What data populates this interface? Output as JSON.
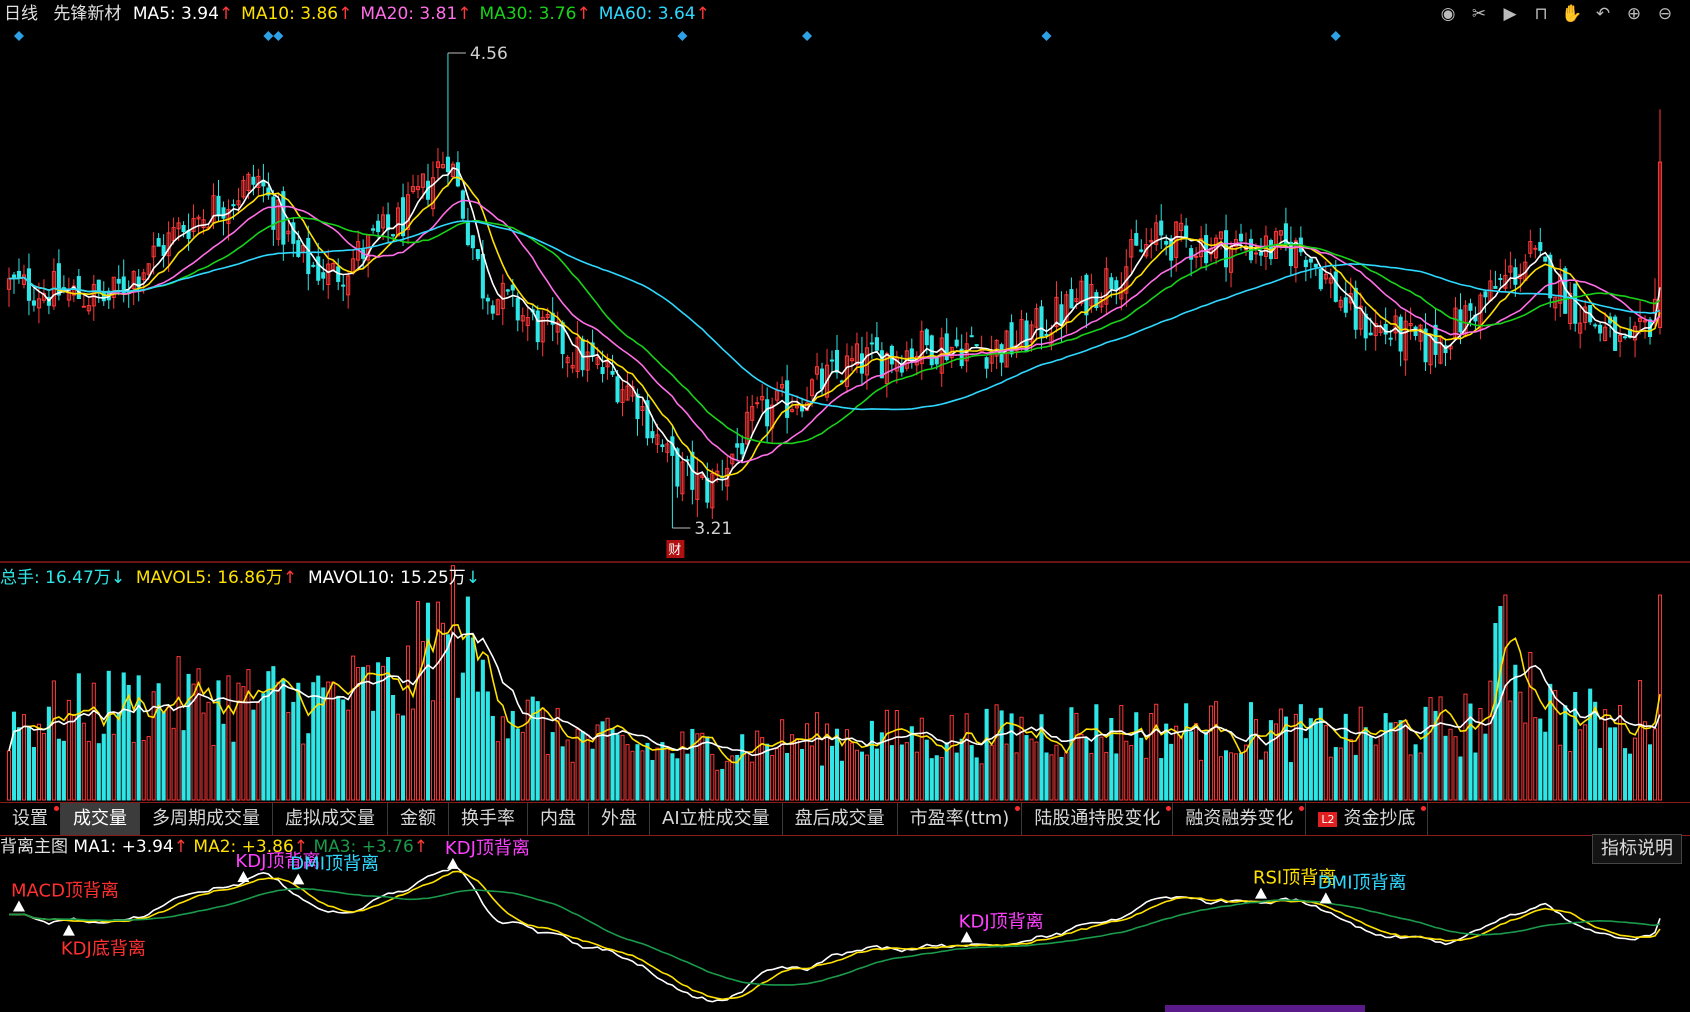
{
  "header": {
    "period": "日线",
    "stock_name": "先锋新材",
    "ma": [
      {
        "label": "MA5",
        "value": "3.94",
        "arrow": "↑",
        "color": "#ffffff"
      },
      {
        "label": "MA10",
        "value": "3.86",
        "arrow": "↑",
        "color": "#ffe100"
      },
      {
        "label": "MA20",
        "value": "3.81",
        "arrow": "↑",
        "color": "#ff6ee6"
      },
      {
        "label": "MA30",
        "value": "3.76",
        "arrow": "↑",
        "color": "#19d219"
      },
      {
        "label": "MA60",
        "value": "3.64",
        "arrow": "↑",
        "color": "#2ed8ff"
      }
    ],
    "tool_icons": [
      "eye-icon",
      "scissors-icon",
      "play-icon",
      "lock-icon",
      "hand-icon",
      "undo-icon",
      "zoom-in-icon",
      "zoom-out-icon"
    ]
  },
  "volume": {
    "total_label": "总手:",
    "total_value": "16.47万",
    "total_arrow": "↓",
    "mavol5_label": "MAVOL5:",
    "mavol5_value": "16.86万",
    "mavol5_arrow": "↑",
    "mavol10_label": "MAVOL10:",
    "mavol10_value": "15.25万",
    "mavol10_arrow": "↓"
  },
  "tabs": [
    {
      "label": "设置",
      "dot": true,
      "active": false
    },
    {
      "label": "成交量",
      "dot": false,
      "active": true
    },
    {
      "label": "多周期成交量",
      "dot": false,
      "active": false
    },
    {
      "label": "虚拟成交量",
      "dot": false,
      "active": false
    },
    {
      "label": "金额",
      "dot": false,
      "active": false
    },
    {
      "label": "换手率",
      "dot": false,
      "active": false
    },
    {
      "label": "内盘",
      "dot": false,
      "active": false
    },
    {
      "label": "外盘",
      "dot": false,
      "active": false
    },
    {
      "label": "AI立桩成交量",
      "dot": false,
      "active": false
    },
    {
      "label": "盘后成交量",
      "dot": false,
      "active": false
    },
    {
      "label": "市盈率(ttm)",
      "dot": true,
      "active": false
    },
    {
      "label": "陆股通持股变化",
      "dot": true,
      "active": false
    },
    {
      "label": "融资融券变化",
      "dot": true,
      "active": false
    },
    {
      "label": "资金抄底",
      "dot": true,
      "active": false,
      "badge": "L2"
    }
  ],
  "indicator": {
    "title": "背离主图",
    "ma1_label": "MA1:",
    "ma1_value": "+3.94",
    "ma1_arrow": "↑",
    "ma2_label": "MA2:",
    "ma2_value": "+3.86",
    "ma2_arrow": "↑",
    "ma3_label": "MA3:",
    "ma3_value": "+3.76",
    "ma3_arrow": "↑",
    "explain_button": "指标说明",
    "signals": [
      {
        "label": "MACD顶背离",
        "bar": 2,
        "pos": "above",
        "color": "#ff3030"
      },
      {
        "label": "KDJ底背离",
        "bar": 12,
        "pos": "below",
        "color": "#ff3030"
      },
      {
        "label": "KDJ顶背离",
        "bar": 47,
        "pos": "above",
        "color": "#ff40ff"
      },
      {
        "label": "DMI顶背离",
        "bar": 58,
        "pos": "above",
        "color": "#2ed8ff"
      },
      {
        "label": "KDJ顶背离",
        "bar": 89,
        "pos": "above",
        "color": "#ff40ff"
      },
      {
        "label": "KDJ顶背离",
        "bar": 192,
        "pos": "above",
        "color": "#ff40ff"
      },
      {
        "label": "RSI顶背离",
        "bar": 251,
        "pos": "above",
        "color": "#ffe100"
      },
      {
        "label": "DMI顶背离",
        "bar": 264,
        "pos": "above",
        "color": "#2ed8ff"
      }
    ]
  },
  "colors": {
    "up": "#ff3838",
    "down": "#2ee6e6",
    "ma5": "#ffffff",
    "ma10": "#ffe100",
    "ma20": "#ff6ee6",
    "ma30": "#19d219",
    "ma60": "#2ed8ff",
    "ind_ma3": "#1a9a4a",
    "divider": "#8a1b1b"
  },
  "chart_data": {
    "type": "candlestick",
    "bars": 332,
    "y_range": [
      3.21,
      4.56
    ],
    "annotations": [
      {
        "label": "4.56",
        "kind": "period-high",
        "value": 4.56
      },
      {
        "label": "3.21",
        "kind": "period-low",
        "value": 3.21
      },
      {
        "label": "财",
        "kind": "event-marker"
      }
    ],
    "event_markers_bars": [
      2,
      52,
      54,
      135,
      160,
      208,
      266
    ],
    "price_keypoints": [
      [
        0,
        3.9
      ],
      [
        20,
        3.86
      ],
      [
        35,
        4.07
      ],
      [
        50,
        4.2
      ],
      [
        58,
        3.97
      ],
      [
        65,
        3.93
      ],
      [
        80,
        4.1
      ],
      [
        88,
        4.28
      ],
      [
        95,
        3.9
      ],
      [
        110,
        3.74
      ],
      [
        125,
        3.6
      ],
      [
        133,
        3.38
      ],
      [
        140,
        3.32
      ],
      [
        150,
        3.52
      ],
      [
        170,
        3.68
      ],
      [
        185,
        3.73
      ],
      [
        200,
        3.72
      ],
      [
        215,
        3.86
      ],
      [
        230,
        4.03
      ],
      [
        245,
        4.01
      ],
      [
        260,
        4.0
      ],
      [
        270,
        3.8
      ],
      [
        285,
        3.72
      ],
      [
        305,
        3.98
      ],
      [
        315,
        3.83
      ],
      [
        325,
        3.7
      ],
      [
        331,
        3.85
      ]
    ],
    "volume_keypoints": [
      [
        0,
        11
      ],
      [
        30,
        14
      ],
      [
        60,
        14
      ],
      [
        80,
        16
      ],
      [
        87,
        28
      ],
      [
        95,
        16
      ],
      [
        110,
        9
      ],
      [
        130,
        7
      ],
      [
        150,
        8
      ],
      [
        170,
        9
      ],
      [
        190,
        9
      ],
      [
        210,
        10
      ],
      [
        240,
        10
      ],
      [
        270,
        9
      ],
      [
        295,
        11
      ],
      [
        300,
        22
      ],
      [
        310,
        12
      ],
      [
        325,
        10
      ],
      [
        331,
        16
      ]
    ],
    "volume_unit": "万"
  }
}
